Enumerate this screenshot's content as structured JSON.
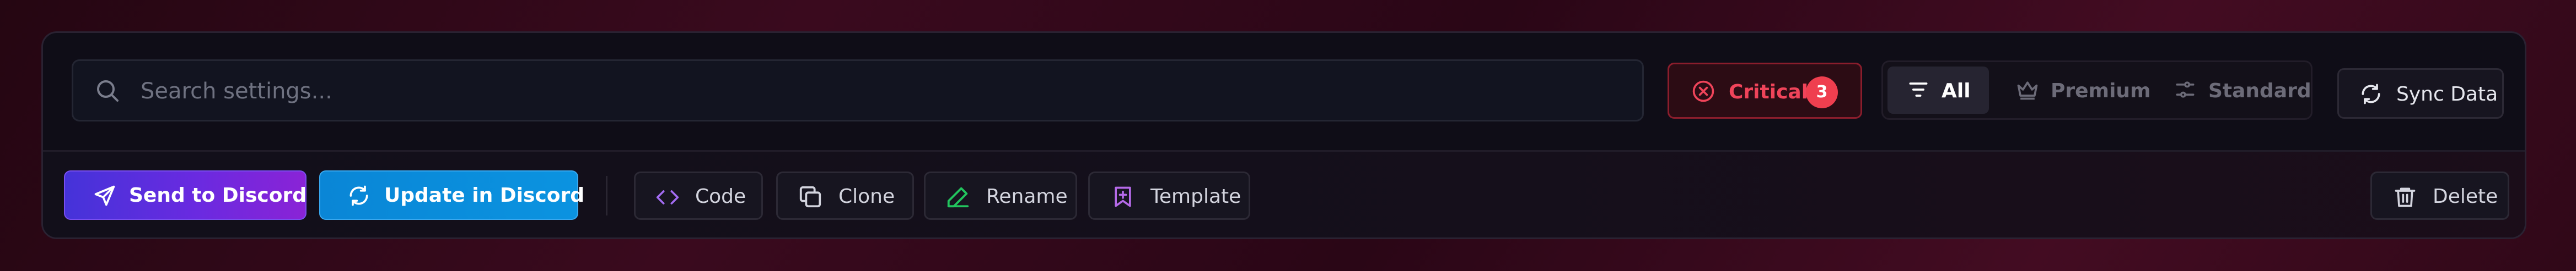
{
  "search": {
    "placeholder": "Search settings...",
    "value": ""
  },
  "critical": {
    "label": "Critical",
    "count": "3"
  },
  "filters": {
    "tabs": [
      {
        "label": "All",
        "icon": "filter-icon",
        "active": true
      },
      {
        "label": "Premium",
        "icon": "crown-icon",
        "active": false
      },
      {
        "label": "Standard",
        "icon": "sliders-icon",
        "active": false
      }
    ]
  },
  "sync": {
    "label": "Sync Data",
    "icon": "refresh-icon"
  },
  "actions": {
    "send": {
      "label": "Send to Discord",
      "icon": "send-icon"
    },
    "update": {
      "label": "Update in Discord",
      "icon": "refresh-icon"
    },
    "code": {
      "label": "Code",
      "icon": "code-icon"
    },
    "clone": {
      "label": "Clone",
      "icon": "copy-icon"
    },
    "rename": {
      "label": "Rename",
      "icon": "pencil-icon"
    },
    "template": {
      "label": "Template",
      "icon": "bookmark-plus-icon"
    },
    "delete": {
      "label": "Delete",
      "icon": "trash-icon"
    }
  },
  "colors": {
    "critical": "#f0445a",
    "send_gradient": [
      "#4533d9",
      "#8a23d6"
    ],
    "update": "#0b93e0",
    "code_icon": "#a36cf2",
    "rename_icon": "#22c55e",
    "template_icon": "#b56ae8"
  }
}
